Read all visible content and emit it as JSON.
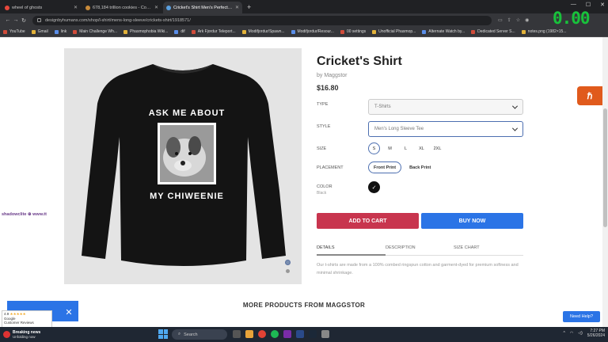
{
  "browser": {
    "tabs": [
      {
        "title": "wheel of ghosts",
        "active": false
      },
      {
        "title": "678,184 trillion cookies - Cooki...",
        "active": false
      },
      {
        "title": "Cricket's Shirt Men's Perfect Tr...",
        "active": true
      }
    ],
    "url": "designbyhumans.com/shop/l-shirt/mens-long-sleeve/crickets-shirt/1918571/",
    "overlay_timer": "0.00",
    "bookmarks": [
      "YouTube",
      "Gmail",
      "link",
      "Main Challenge Wh...",
      "Phasmophobia Wiki...",
      "dif",
      "Ark Fjordur Teleport...",
      "Modifjordur/Spawn...",
      "Modifjordur/Resour...",
      "00 settings",
      "Unofficial Phasmop...",
      "Alternate Watch by...",
      "Dedicated Server S...",
      "notes.png (1982×15..."
    ]
  },
  "product": {
    "image_alt": "Black long sleeve shirt with ASK ME ABOUT MY CHIWEENIE print",
    "print_top": "ASK ME ABOUT",
    "print_bottom": "MY CHIWEENIE",
    "title": "Cricket's Shirt",
    "byline": "by Maggstor",
    "price": "$16.80",
    "options": {
      "type_label": "TYPE",
      "type_value": "T-Shirts",
      "style_label": "STYLE",
      "style_value": "Men's Long Sleeve Tee",
      "size_label": "SIZE",
      "sizes": [
        "S",
        "M",
        "L",
        "XL",
        "2XL"
      ],
      "selected_size": "S",
      "placement_label": "PLACEMENT",
      "placements": [
        "Front Print",
        "Back Print"
      ],
      "selected_placement": "Front Print",
      "color_label": "COLOR",
      "color_value": "Black",
      "color_hex": "#111111"
    },
    "add_to_cart": "ADD TO CART",
    "buy_now": "BUY NOW",
    "info_tabs": [
      "DETAILS",
      "DESCRIPTION",
      "SIZE CHART"
    ],
    "details_text": "Our t-shirts are made from a 100% combed ringspun cotton and garment-dyed for premium softness and minimal shrinkage."
  },
  "more_products": "MORE PRODUCTS FROM MAGGSTOR",
  "widgets": {
    "side_badge": "ℏ",
    "need_help": "Need Help?",
    "google_rating": "4.9",
    "google_stars": "★★★★★",
    "google_line1": "Google",
    "google_line2": "Customer Reviews",
    "stream_label": "shadowclite ⊕ www.tt",
    "promo_close": "✕"
  },
  "taskbar": {
    "news_title": "Breaking news",
    "news_sub": "Unfolding now",
    "search_placeholder": "Search",
    "time": "7:27 PM",
    "date": "5/26/2024"
  },
  "colors": {
    "accent_blue": "#2b74e6",
    "cart_red": "#c8354e",
    "overlay_green": "#18c23b"
  }
}
